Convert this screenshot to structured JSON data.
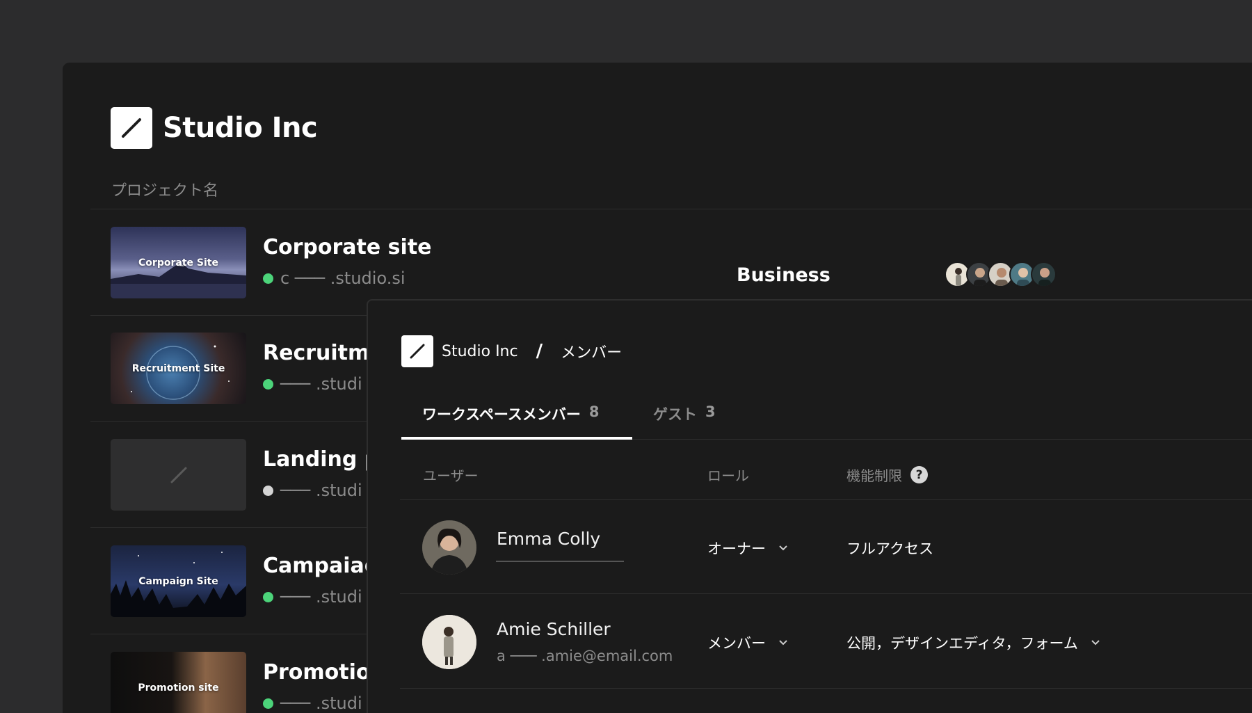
{
  "workspace": {
    "name": "Studio Inc"
  },
  "project_list": {
    "column_header": "プロジェクト名",
    "projects": [
      {
        "thumb_label": "Corporate Site",
        "title": "Corporate site",
        "url": "c ─── .studio.si",
        "status_color": "#4cd47a"
      },
      {
        "thumb_label": "Recruitment Site",
        "title": "Recruitme",
        "url": "─── .studi",
        "status_color": "#4cd47a"
      },
      {
        "thumb_label": "",
        "title": "Landing p",
        "url": "─── .studi",
        "status_color": "#d4d4d4"
      },
      {
        "thumb_label": "Campaign Site",
        "title": "Campaiag",
        "url": "─── .studi",
        "status_color": "#4cd47a"
      },
      {
        "thumb_label": "Promotion site",
        "title": "Promotion",
        "url": "─── .studi",
        "status_color": "#4cd47a"
      }
    ],
    "first_row_plan": "Business"
  },
  "members_panel": {
    "breadcrumb": {
      "workspace": "Studio Inc",
      "separator": "/",
      "page": "メンバー"
    },
    "tabs": [
      {
        "label": "ワークスペースメンバー",
        "count": "8",
        "active": true
      },
      {
        "label": "ゲスト",
        "count": "3",
        "active": false
      }
    ],
    "columns": {
      "user": "ユーザー",
      "role": "ロール",
      "restrictions": "機能制限",
      "help": "?"
    },
    "members": [
      {
        "name": "Emma Colly",
        "email": "",
        "role": "オーナー",
        "restrictions": "フルアクセス"
      },
      {
        "name": "Amie Schiller",
        "email": "a ─── .amie@email.com",
        "role": "メンバー",
        "restrictions": "公開，デザインエディタ，フォーム"
      }
    ]
  },
  "colors": {
    "background": "#2c2c2d",
    "surface": "#1b1b1b",
    "accent_green": "#4cd47a"
  }
}
